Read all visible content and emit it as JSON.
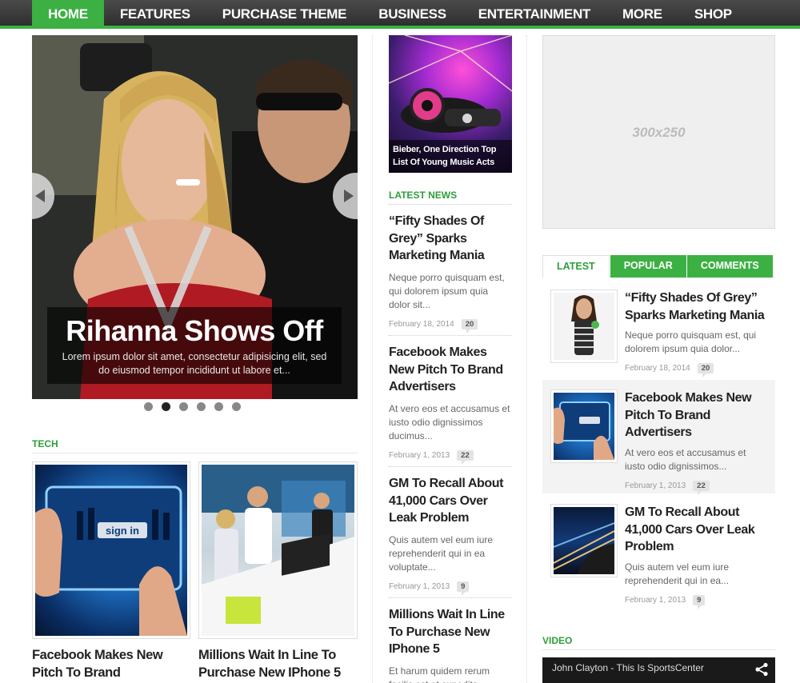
{
  "nav": {
    "items": [
      {
        "label": "HOME"
      },
      {
        "label": "FEATURES"
      },
      {
        "label": "PURCHASE THEME"
      },
      {
        "label": "BUSINESS"
      },
      {
        "label": "ENTERTAINMENT"
      },
      {
        "label": "MORE"
      },
      {
        "label": "SHOP"
      }
    ],
    "active": "HOME"
  },
  "slider": {
    "title": "Rihanna Shows Off",
    "excerpt": "Lorem ipsum dolor sit amet, consectetur adipisicing elit, sed do eiusmod tempor incididunt ut labore et...",
    "slide_count": 6,
    "active_slide": 2
  },
  "tech": {
    "heading": "TECH",
    "articles": [
      {
        "title": "Facebook Makes New Pitch To Brand Advertisers"
      },
      {
        "title": "Millions Wait In Line To Purchase New IPhone 5"
      }
    ]
  },
  "featured": {
    "caption": "Bieber, One Direction Top List Of Young Music Acts"
  },
  "latest_news": {
    "heading": "LATEST NEWS",
    "items": [
      {
        "title": "“Fifty Shades Of Grey” Sparks Marketing Mania",
        "excerpt": "Neque porro quisquam est, qui dolorem ipsum quia dolor sit...",
        "date": "February 18, 2014",
        "comments": "20"
      },
      {
        "title": "Facebook Makes New Pitch To Brand Advertisers",
        "excerpt": "At vero eos et accusamus et iusto odio dignissimos ducimus...",
        "date": "February 1, 2013",
        "comments": "22"
      },
      {
        "title": "GM To Recall About 41,000 Cars Over Leak Problem",
        "excerpt": "Quis autem vel eum iure reprehenderit qui in ea voluptate...",
        "date": "February 1, 2013",
        "comments": "9"
      },
      {
        "title": "Millions Wait In Line To Purchase New IPhone 5",
        "excerpt": "Et harum quidem rerum facilis est et expedita..."
      }
    ]
  },
  "ad": {
    "label": "300x250"
  },
  "sidebar_tabs": {
    "tabs": [
      {
        "label": "LATEST"
      },
      {
        "label": "POPULAR"
      },
      {
        "label": "COMMENTS"
      }
    ],
    "active": "LATEST",
    "items": [
      {
        "title": "“Fifty Shades Of Grey” Sparks Marketing Mania",
        "excerpt": "Neque porro quisquam est, qui dolorem ipsum quia dolor...",
        "date": "February 18, 2014",
        "comments": "20"
      },
      {
        "title": "Facebook Makes New Pitch To Brand Advertisers",
        "excerpt": "At vero eos et accusamus et iusto odio dignissimos...",
        "date": "February 1, 2013",
        "comments": "22"
      },
      {
        "title": "GM To Recall About 41,000 Cars Over Leak Problem",
        "excerpt": "Quis autem vel eum iure reprehenderit qui in ea...",
        "date": "February 1, 2013",
        "comments": "9"
      }
    ]
  },
  "video": {
    "heading": "VIDEO",
    "title": "John Clayton - This Is SportsCenter"
  },
  "colors": {
    "accent": "#3cb043",
    "nav_bg": "#3a3a3a"
  }
}
